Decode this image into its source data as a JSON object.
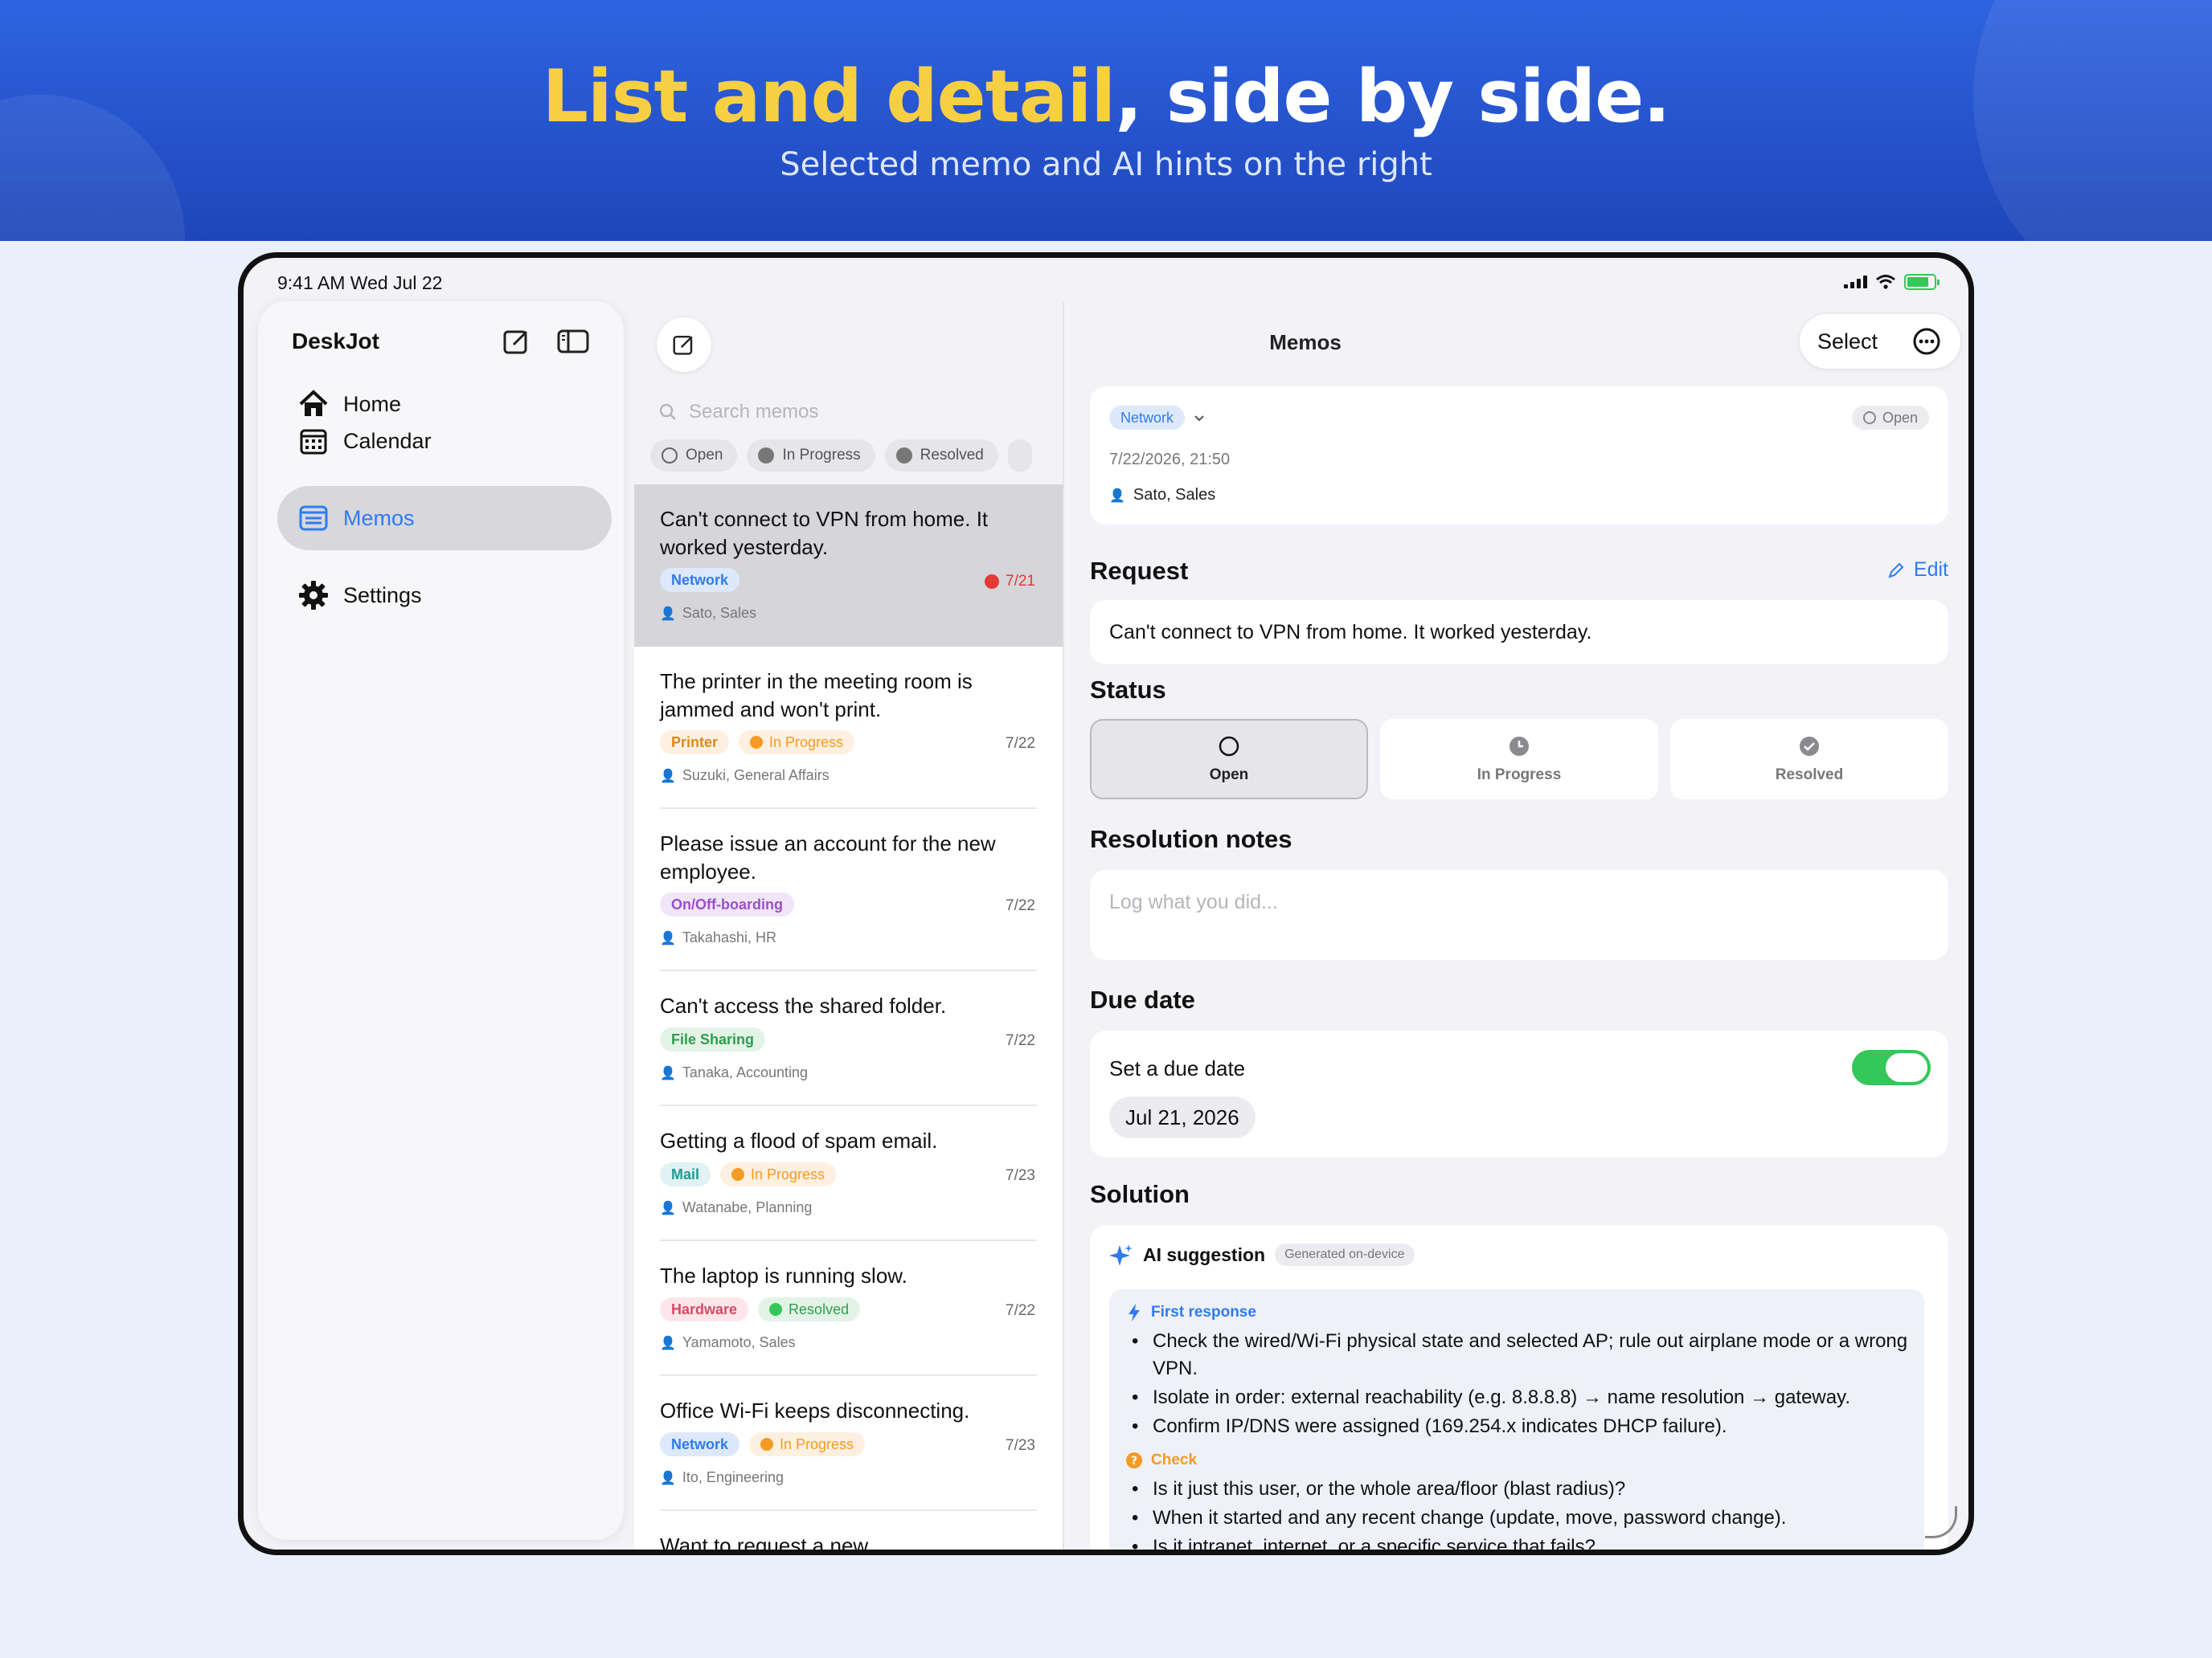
{
  "banner": {
    "headline_highlight": "List and detail",
    "headline_rest": ", side by side.",
    "subheadline": "Selected memo and AI hints on the right"
  },
  "statusbar": {
    "time": "9:41 AM   Wed Jul 22"
  },
  "sidebar": {
    "app_name": "DeskJot",
    "items": [
      {
        "label": "Home",
        "icon": "house-icon",
        "active": false
      },
      {
        "label": "Calendar",
        "icon": "calendar-icon",
        "active": false
      },
      {
        "label": "Memos",
        "icon": "memo-list-icon",
        "active": true
      },
      {
        "label": "Settings",
        "icon": "gear-icon",
        "active": false
      }
    ]
  },
  "list": {
    "search_placeholder": "Search memos",
    "filters": [
      "Open",
      "In Progress",
      "Resolved"
    ],
    "memos": [
      {
        "title": "Can't connect to VPN from home. It worked yesterday.",
        "category": "Network",
        "status": "",
        "date": "7/21",
        "overdue": true,
        "person": "Sato, Sales"
      },
      {
        "title": "The printer in the meeting room is jammed and won't print.",
        "category": "Printer",
        "status": "In Progress",
        "date": "7/22",
        "overdue": false,
        "person": "Suzuki, General Affairs"
      },
      {
        "title": "Please issue an account for the new employee.",
        "category": "On/Off-boarding",
        "status": "",
        "date": "7/22",
        "overdue": false,
        "person": "Takahashi, HR"
      },
      {
        "title": "Can't access the shared folder.",
        "category": "File Sharing",
        "status": "",
        "date": "7/22",
        "overdue": false,
        "person": "Tanaka, Accounting"
      },
      {
        "title": "Getting a flood of spam email.",
        "category": "Mail",
        "status": "In Progress",
        "date": "7/23",
        "overdue": false,
        "person": "Watanabe, Planning"
      },
      {
        "title": "The laptop is running slow.",
        "category": "Hardware",
        "status": "Resolved",
        "date": "7/22",
        "overdue": false,
        "person": "Yamamoto, Sales"
      },
      {
        "title": "Office Wi-Fi keeps disconnecting.",
        "category": "Network",
        "status": "In Progress",
        "date": "7/23",
        "overdue": false,
        "person": "Ito, Engineering"
      },
      {
        "title": "Want to request a new",
        "category": "",
        "status": "",
        "date": "",
        "overdue": false,
        "person": ""
      }
    ]
  },
  "detail": {
    "nav_title": "Memos",
    "select_label": "Select",
    "header": {
      "category": "Network",
      "status": "Open",
      "datetime": "7/22/2026, 21:50",
      "person": "Sato, Sales"
    },
    "request": {
      "heading": "Request",
      "edit_label": "Edit",
      "text": "Can't connect to VPN from home. It worked yesterday."
    },
    "status": {
      "heading": "Status",
      "options": [
        "Open",
        "In Progress",
        "Resolved"
      ],
      "selected": "Open"
    },
    "notes": {
      "heading": "Resolution notes",
      "placeholder": "Log what you did..."
    },
    "due": {
      "heading": "Due date",
      "label": "Set a due date",
      "enabled": true,
      "date": "Jul 21, 2026"
    },
    "solution": {
      "heading": "Solution",
      "ai_title": "AI suggestion",
      "ai_badge": "Generated on-device",
      "first_title": "First response",
      "first_items": [
        "Check the wired/Wi-Fi physical state and selected AP; rule out airplane mode or a wrong VPN.",
        "Isolate in order: external reachability (e.g. 8.8.8.8) → name resolution → gateway.",
        "Confirm IP/DNS were assigned (169.254.x indicates DHCP failure)."
      ],
      "check_title": "Check",
      "check_items": [
        "Is it just this user, or the whole area/floor (blast radius)?",
        "When it started and any recent change (update, move, password change).",
        "Is it intranet, internet, or a specific service that fails?"
      ]
    }
  },
  "colors": {
    "accent": "#2f7bf0",
    "overdue": "#e53935",
    "progress": "#f59a23",
    "resolved": "#34c759",
    "toggle_on": "#34c759"
  }
}
